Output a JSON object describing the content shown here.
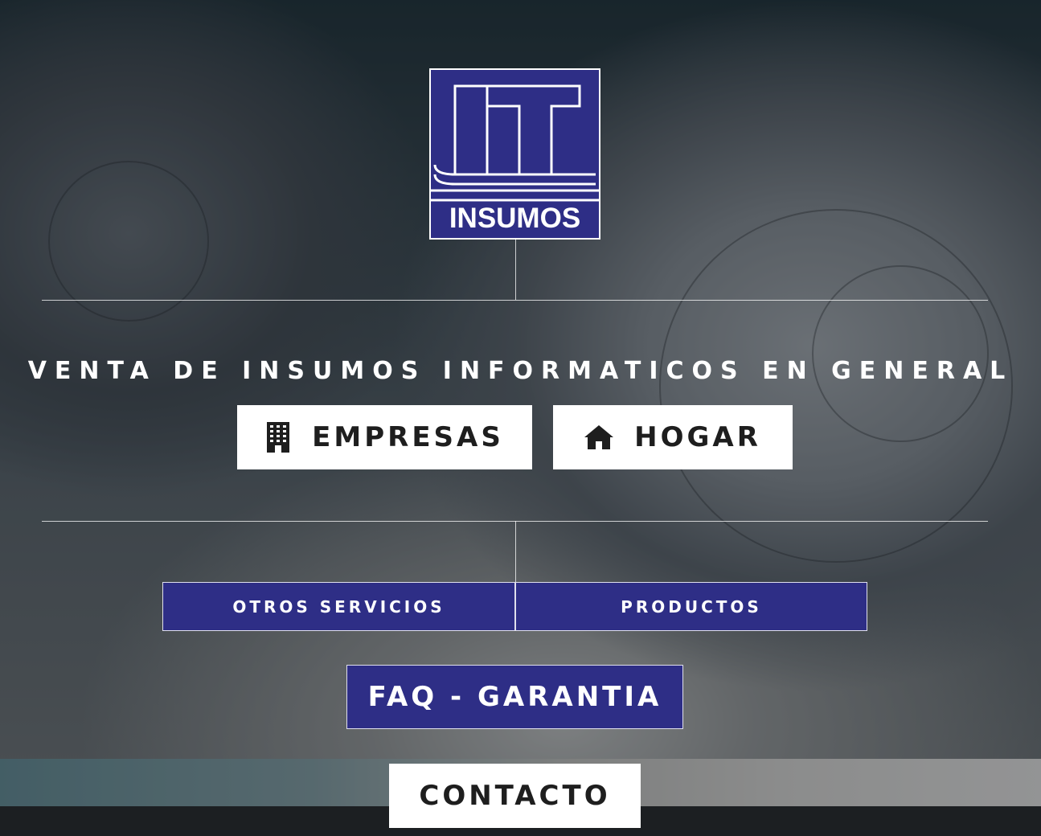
{
  "brand": {
    "logo_text": "INSUMOS",
    "logo_mark": "IT",
    "colors": {
      "brand_blue": "#2e2e86",
      "white": "#ffffff"
    }
  },
  "hero": {
    "tagline": "VENTA DE INSUMOS INFORMATICOS EN GENERAL"
  },
  "nav": {
    "empresas": {
      "label": "EMPRESAS",
      "icon": "building-icon"
    },
    "hogar": {
      "label": "HOGAR",
      "icon": "home-icon"
    },
    "otros_servicios": {
      "label": "OTROS SERVICIOS"
    },
    "productos": {
      "label": "PRODUCTOS"
    },
    "faq": {
      "label": "FAQ - GARANTIA"
    },
    "contacto": {
      "label": "CONTACTO"
    }
  }
}
